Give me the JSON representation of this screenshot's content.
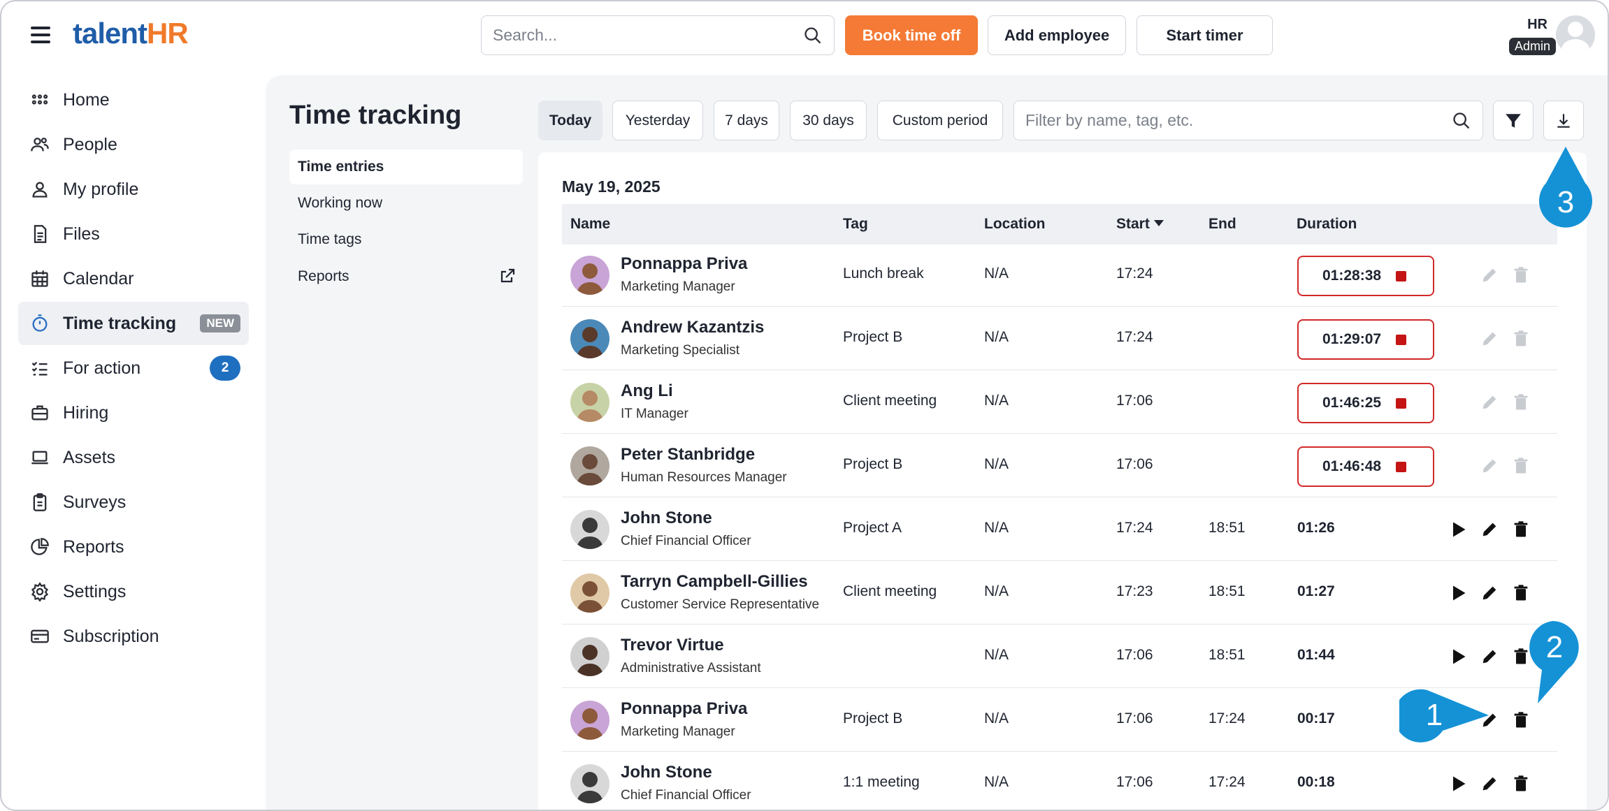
{
  "header": {
    "logo_talent": "talent",
    "logo_hr": "HR",
    "search_placeholder": "Search...",
    "book_time_off": "Book time off",
    "add_employee": "Add employee",
    "start_timer": "Start timer",
    "user_name": "HR",
    "user_role": "Admin"
  },
  "sidebar": {
    "items": [
      {
        "label": "Home",
        "icon": "grid-icon"
      },
      {
        "label": "People",
        "icon": "people-icon"
      },
      {
        "label": "My profile",
        "icon": "user-icon"
      },
      {
        "label": "Files",
        "icon": "file-icon"
      },
      {
        "label": "Calendar",
        "icon": "calendar-icon"
      },
      {
        "label": "Time tracking",
        "icon": "stopwatch-icon",
        "badge": "NEW",
        "active": true
      },
      {
        "label": "For action",
        "icon": "checklist-icon",
        "count": "2"
      },
      {
        "label": "Hiring",
        "icon": "briefcase-icon"
      },
      {
        "label": "Assets",
        "icon": "laptop-icon"
      },
      {
        "label": "Surveys",
        "icon": "clipboard-icon"
      },
      {
        "label": "Reports",
        "icon": "pie-chart-icon"
      },
      {
        "label": "Settings",
        "icon": "gear-icon"
      },
      {
        "label": "Subscription",
        "icon": "card-icon"
      }
    ]
  },
  "page": {
    "title": "Time tracking",
    "subnav": [
      "Time entries",
      "Working now",
      "Time tags",
      "Reports"
    ],
    "ranges": [
      "Today",
      "Yesterday",
      "7 days",
      "30 days",
      "Custom period"
    ],
    "filter_placeholder": "Filter by name, tag, etc.",
    "date": "May 19, 2025"
  },
  "table": {
    "headers": {
      "name": "Name",
      "tag": "Tag",
      "location": "Location",
      "start": "Start",
      "end": "End",
      "duration": "Duration"
    },
    "rows": [
      {
        "name": "Ponnappa Priva",
        "role": "Marketing Manager",
        "tag": "Lunch break",
        "location": "N/A",
        "start": "17:24",
        "end": "",
        "duration": "01:28:38",
        "running": true
      },
      {
        "name": "Andrew Kazantzis",
        "role": "Marketing Specialist",
        "tag": "Project B",
        "location": "N/A",
        "start": "17:24",
        "end": "",
        "duration": "01:29:07",
        "running": true
      },
      {
        "name": "Ang Li",
        "role": "IT Manager",
        "tag": "Client meeting",
        "location": "N/A",
        "start": "17:06",
        "end": "",
        "duration": "01:46:25",
        "running": true
      },
      {
        "name": "Peter Stanbridge",
        "role": "Human Resources Manager",
        "tag": "Project B",
        "location": "N/A",
        "start": "17:06",
        "end": "",
        "duration": "01:46:48",
        "running": true
      },
      {
        "name": "John Stone",
        "role": "Chief Financial Officer",
        "tag": "Project A",
        "location": "N/A",
        "start": "17:24",
        "end": "18:51",
        "duration": "01:26",
        "running": false
      },
      {
        "name": "Tarryn Campbell-Gillies",
        "role": "Customer Service Representative",
        "tag": "Client meeting",
        "location": "N/A",
        "start": "17:23",
        "end": "18:51",
        "duration": "01:27",
        "running": false
      },
      {
        "name": "Trevor Virtue",
        "role": "Administrative Assistant",
        "tag": "",
        "location": "N/A",
        "start": "17:06",
        "end": "18:51",
        "duration": "01:44",
        "running": false
      },
      {
        "name": "Ponnappa Priva",
        "role": "Marketing Manager",
        "tag": "Project B",
        "location": "N/A",
        "start": "17:06",
        "end": "17:24",
        "duration": "00:17",
        "running": false
      },
      {
        "name": "John Stone",
        "role": "Chief Financial Officer",
        "tag": "1:1 meeting",
        "location": "N/A",
        "start": "17:06",
        "end": "17:24",
        "duration": "00:18",
        "running": false
      }
    ]
  },
  "callouts": [
    "1",
    "2",
    "3"
  ],
  "colors": {
    "accent_blue": "#1f5da8",
    "orange": "#f47a35",
    "callout": "#1592d6",
    "running_red": "#d12a2a"
  }
}
